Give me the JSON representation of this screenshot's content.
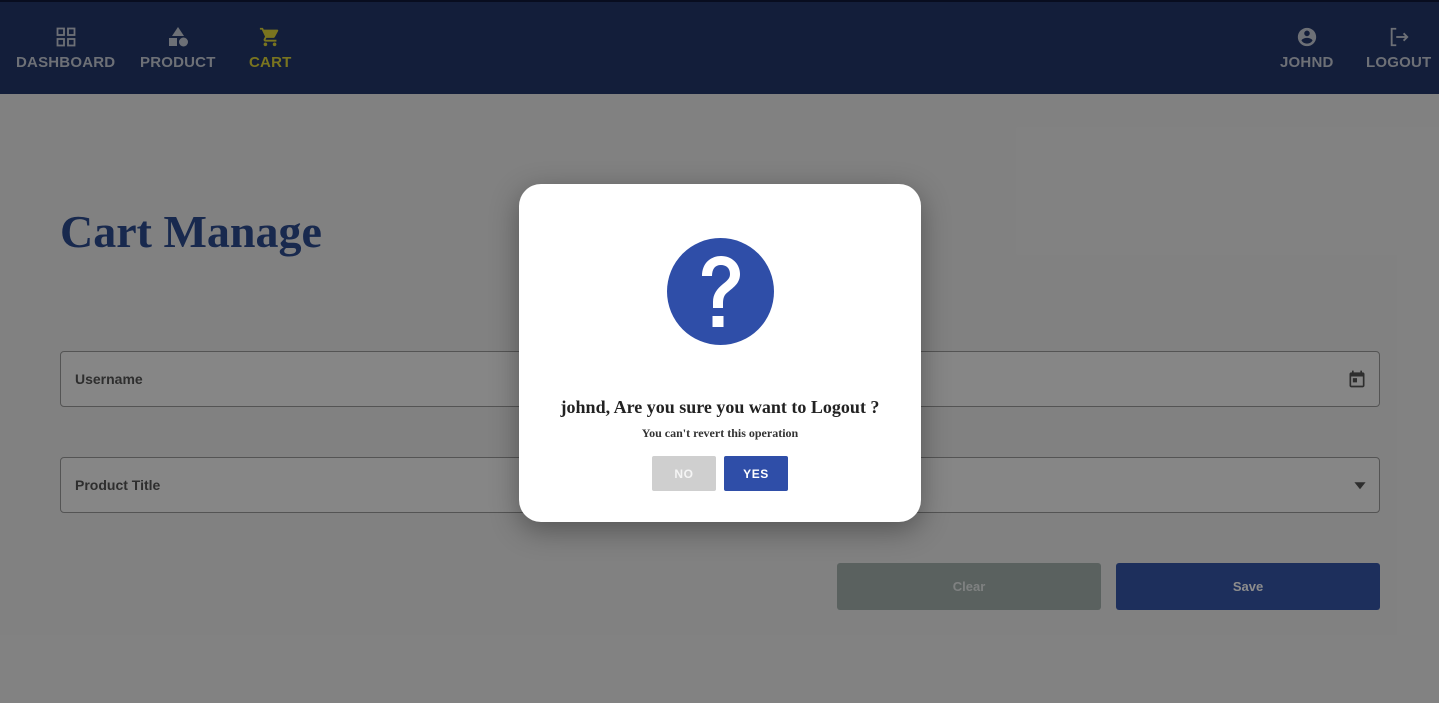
{
  "nav": {
    "left_items": [
      {
        "label": "DASHBOARD",
        "icon": "dashboard-icon"
      },
      {
        "label": "PRODUCT",
        "icon": "category-icon"
      },
      {
        "label": "CART",
        "icon": "cart-icon",
        "active": true
      }
    ],
    "right_items": [
      {
        "label": "JOHND",
        "icon": "account-icon"
      },
      {
        "label": "LOGOUT",
        "icon": "logout-icon"
      }
    ],
    "colors": {
      "background": "#24376b",
      "active": "#dcd43a",
      "inactive": "#c7ccd8"
    }
  },
  "page": {
    "title": "Cart Manage",
    "fields": {
      "username": {
        "label": "Username"
      },
      "date": {
        "icon": "calendar-icon"
      },
      "product_title": {
        "label": "Product Title"
      },
      "quantity_select": {
        "icon": "dropdown-arrow-icon"
      }
    },
    "buttons": {
      "clear": "Clear",
      "save": "Save"
    }
  },
  "modal": {
    "icon": "question-icon",
    "title": "johnd, Are you sure you want to Logout ?",
    "subtitle": "You can't revert this operation",
    "no_label": "NO",
    "yes_label": "YES",
    "accent_color": "#2f4ea8"
  }
}
